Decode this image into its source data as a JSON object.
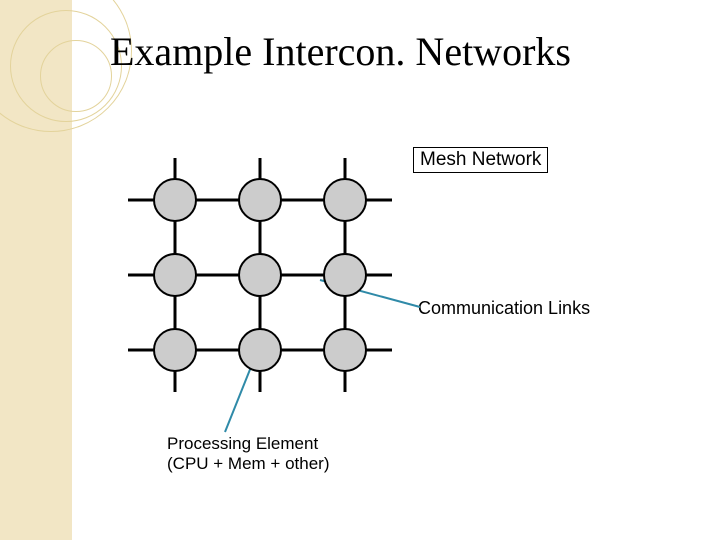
{
  "title": "Example Intercon. Networks",
  "labels": {
    "mesh": "Mesh Network",
    "comm": "Communication Links",
    "pe_line1": "Processing Element",
    "pe_line2": "(CPU + Mem + other)"
  },
  "diagram": {
    "type": "mesh",
    "rows": 3,
    "cols": 3,
    "node_label": "Processing Element (CPU + Mem + other)",
    "edge_label": "Communication Links",
    "colors": {
      "node_fill": "#cccccc",
      "node_stroke": "#000000",
      "grid_stroke": "#000000",
      "callout_stroke": "#2f8aa8",
      "accent_bg": "#f2e6c5"
    }
  }
}
